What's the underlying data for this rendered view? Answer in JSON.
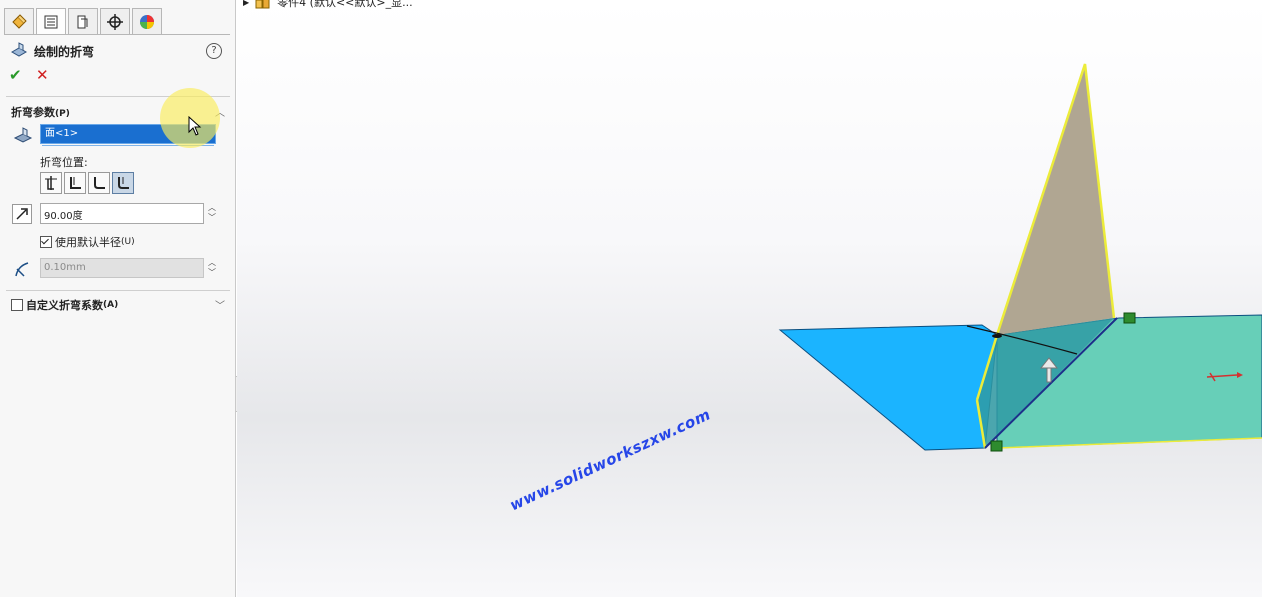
{
  "panel": {
    "tabs": [
      {
        "name": "feature-manager-tab-icon"
      },
      {
        "name": "property-manager-tab-icon"
      },
      {
        "name": "configuration-manager-tab-icon"
      },
      {
        "name": "dimxpert-manager-tab-icon"
      },
      {
        "name": "display-manager-tab-icon"
      }
    ],
    "title": "绘制的折弯",
    "help": "?",
    "ok": "✔",
    "cancel": "✕",
    "bend_params": {
      "title": "折弯参数",
      "shortcut": "(P)",
      "face_value": "面<1>",
      "position_label": "折弯位置:",
      "selected_position_index": 3,
      "angle_value": "90.00度",
      "use_default_radius_label": "使用默认半径",
      "use_default_radius_shortcut": "(U)",
      "use_default_radius_checked": true,
      "radius_value": "0.10mm"
    },
    "custom_allowance": {
      "label": "自定义折弯系数",
      "shortcut": "(A)",
      "checked": false
    }
  },
  "viewport": {
    "tree_item": "零件4 (默认<<默认>_显..."
  },
  "watermark": "www.solidworkszxw.com",
  "colors": {
    "face_selected": "#1a6fd0",
    "sheet_left": "#1bb4ff",
    "sheet_right": "#67cfb8",
    "flange": "#b0a692",
    "edge_highlight": "#ecec3a",
    "watermark": "#2646e8"
  }
}
